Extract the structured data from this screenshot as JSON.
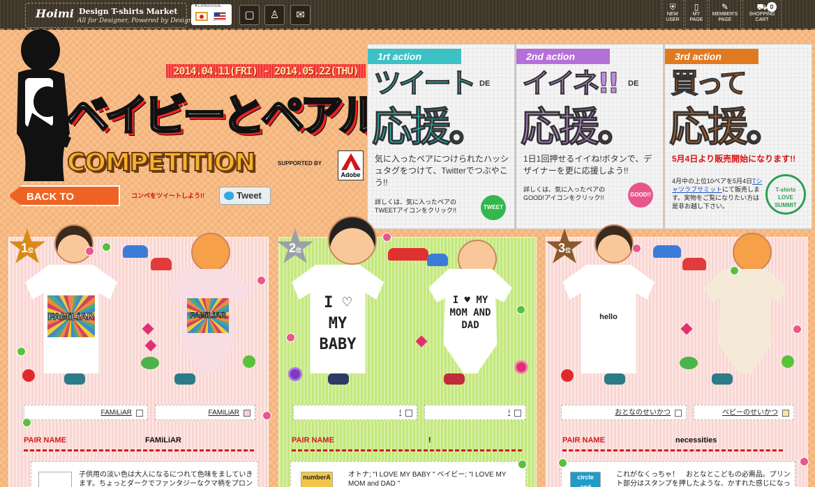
{
  "header": {
    "brand": "Hoimi",
    "site_name": "Design T-shirts Market",
    "tagline": "All for Designer, Powered by Designer",
    "language_label": "▼LANGUAGE",
    "nav": [
      {
        "id": "new-user",
        "label": "NEW USER",
        "icon": "user-shield-icon"
      },
      {
        "id": "my-page",
        "label": "MY PAGE",
        "icon": "phone-page-icon"
      },
      {
        "id": "member",
        "label": "MEMBER'S PAGE",
        "icon": "pencil-icon"
      },
      {
        "id": "cart",
        "label": "SHOPPING CART",
        "icon": "cart-icon",
        "count": "0"
      }
    ],
    "tool_icons": [
      "book-icon",
      "tshirt-icon",
      "mail-icon"
    ]
  },
  "hero": {
    "dates": "2014.04.11(FRI) - 2014.05.22(THU)",
    "title_jp": "ベイビーとペアルック",
    "title_en": "COMPETITION",
    "supported": "SUPPORTED BY",
    "sponsor": "Adobe",
    "back_label": "BACK TO TOPPAGE",
    "tweet_pitch": "コンペをツイートしよう!!",
    "tweet_label": "Tweet"
  },
  "actions": [
    {
      "label": "1rt action",
      "head": "ツイート",
      "deco": "DE",
      "big": "応援。",
      "desc": "気に入ったペアにつけられたハッシュタグをつけて、Twitterでつぶやこう!!",
      "note": "詳しくは、気に入ったペアのTWEETアイコンをクリック!!",
      "icon": "TWEET"
    },
    {
      "label": "2nd action",
      "head": "イイネ!!",
      "deco": "DE",
      "big": "応援。",
      "desc": "1日1回押せるイイね!ボタンで、デザイナーを更に応援しよう!!",
      "note": "詳しくは、気に入ったペアのGOOD!アイコンをクリック!!",
      "icon": "GOOD!!"
    },
    {
      "label": "3rd action",
      "head": "買って",
      "big": "応援。",
      "desc": "5月4日より販売開始になります!!",
      "note_pre": "4月中の上位10ペアを5月4日",
      "note_link": "Tシャツラブサミット",
      "note_post": "にて販売します。実物をご覧になりたい方は是非お越し下さい。",
      "stamp": "T-shirts LOVE SUMMIT"
    }
  ],
  "rankings": [
    {
      "rank": "1",
      "rank_suffix": "位",
      "shirt_print": "FAMiLiAR",
      "romper_print": "FAMiLiAR",
      "parent_label": "FAMiLiAR",
      "baby_label": "FAMiLiAR",
      "pair_label": "PAIR NAME",
      "pair_name": "FAMiLiAR",
      "desc": "子供用の淡い色は大人になるにつれて色味をましていきます。ちょっとダークでファンタジーなクマ柄をプロン",
      "thumb": ""
    },
    {
      "rank": "2",
      "rank_suffix": "位",
      "shirt_print": "I ♡ MY BABY",
      "romper_print": "I ♥ MY MOM AND DAD",
      "parent_label": "!",
      "baby_label": "!",
      "pair_label": "PAIR NAME",
      "pair_name": "!",
      "desc": "オトナ; \"I LOVE MY BABY \" ベイビー; \"I LOVE MY MOM and DAD \"",
      "thumb": "numberA"
    },
    {
      "rank": "3",
      "rank_suffix": "位",
      "shirt_print": "hello",
      "romper_print": "",
      "parent_label": "おとなのせいかつ",
      "baby_label": "ベビーのせいかつ",
      "pair_label": "PAIR NAME",
      "pair_name": "necessities",
      "desc": "これがなくっちゃ！　おとなとこどもの必需品。プリント部分はスタンプを押したような、かすれた感じになっ",
      "thumb": "circle and"
    }
  ]
}
